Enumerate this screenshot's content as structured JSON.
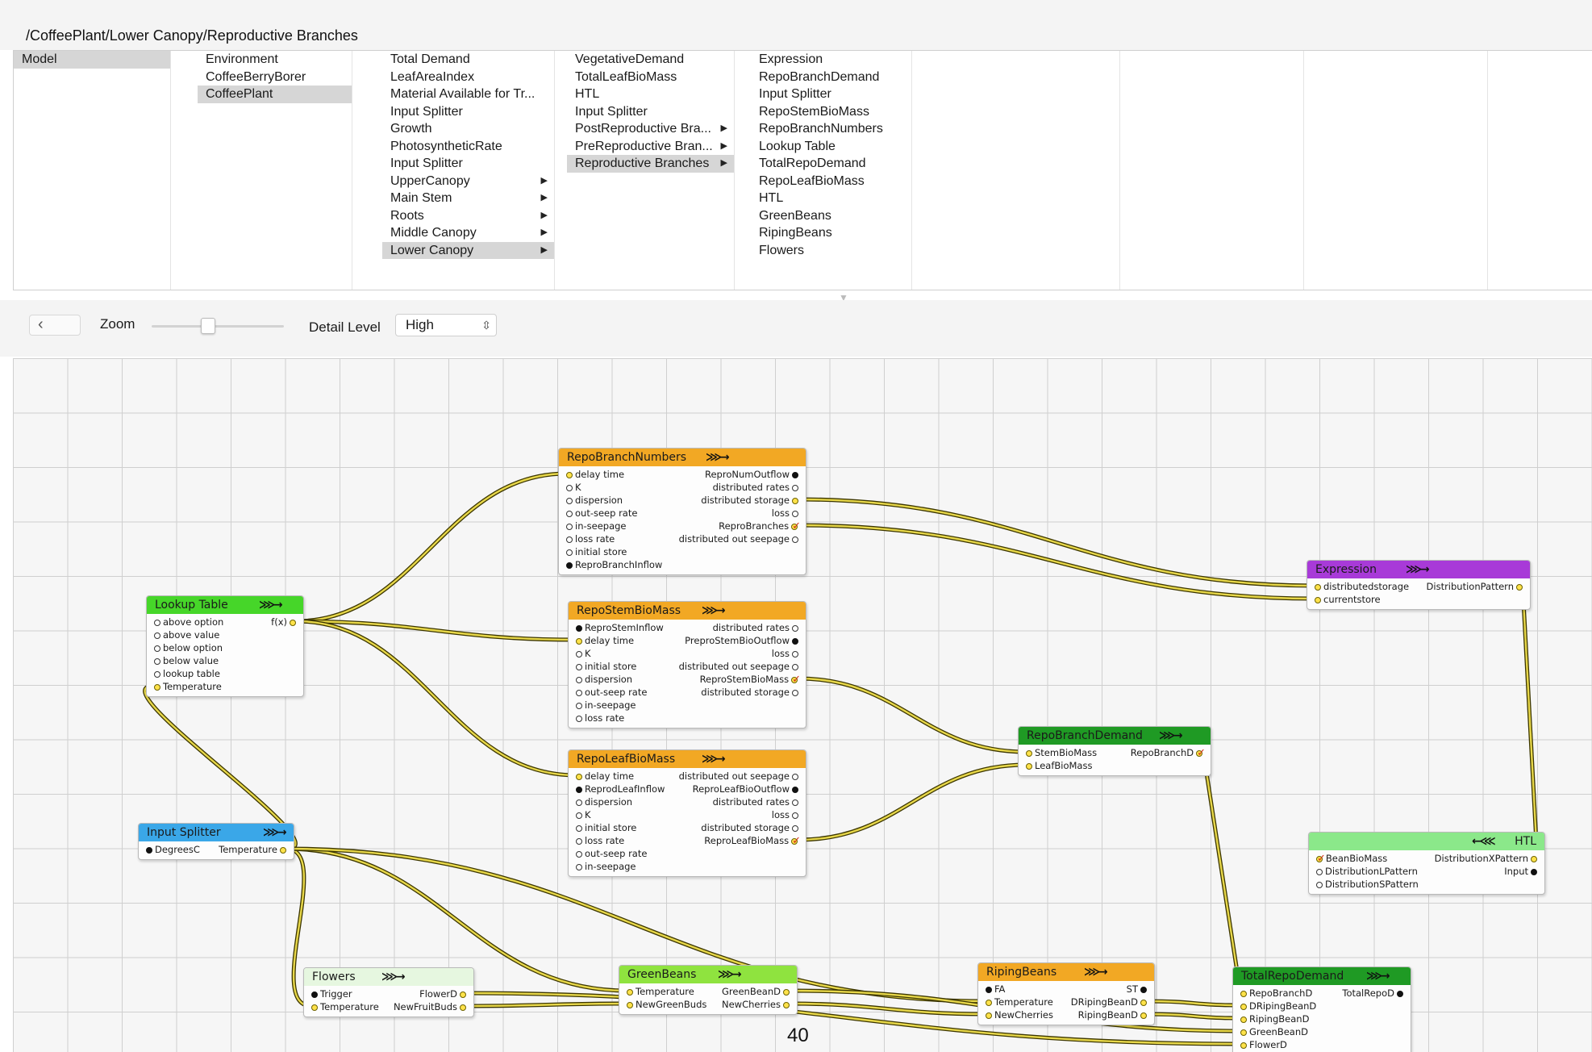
{
  "path": "/CoffeePlant/Lower Canopy/Reproductive Branches",
  "browser": {
    "columns": [
      {
        "items": [
          {
            "label": "Model",
            "selected": true,
            "arrow": false
          }
        ]
      },
      {
        "items": [
          {
            "label": "Environment",
            "selected": false,
            "arrow": false
          },
          {
            "label": "CoffeeBerryBorer",
            "selected": false,
            "arrow": false
          },
          {
            "label": "CoffeePlant",
            "selected": true,
            "arrow": false
          }
        ]
      },
      {
        "items": [
          {
            "label": "Total Demand",
            "selected": false,
            "arrow": false
          },
          {
            "label": "LeafAreaIndex",
            "selected": false,
            "arrow": false
          },
          {
            "label": "Material Available for Tr...",
            "selected": false,
            "arrow": false
          },
          {
            "label": "Input Splitter",
            "selected": false,
            "arrow": false
          },
          {
            "label": "Growth",
            "selected": false,
            "arrow": false
          },
          {
            "label": "PhotosyntheticRate",
            "selected": false,
            "arrow": false
          },
          {
            "label": "Input Splitter",
            "selected": false,
            "arrow": false
          },
          {
            "label": "UpperCanopy",
            "selected": false,
            "arrow": true
          },
          {
            "label": "Main Stem",
            "selected": false,
            "arrow": true
          },
          {
            "label": "Roots",
            "selected": false,
            "arrow": true
          },
          {
            "label": "Middle Canopy",
            "selected": false,
            "arrow": true
          },
          {
            "label": "Lower Canopy",
            "selected": true,
            "arrow": true
          }
        ]
      },
      {
        "items": [
          {
            "label": "VegetativeDemand",
            "selected": false,
            "arrow": false
          },
          {
            "label": "TotalLeafBioMass",
            "selected": false,
            "arrow": false
          },
          {
            "label": "HTL",
            "selected": false,
            "arrow": false
          },
          {
            "label": "Input Splitter",
            "selected": false,
            "arrow": false
          },
          {
            "label": "PostReproductive Bra...",
            "selected": false,
            "arrow": true
          },
          {
            "label": "PreReproductive Bran...",
            "selected": false,
            "arrow": true
          },
          {
            "label": "Reproductive Branches",
            "selected": true,
            "arrow": true
          }
        ]
      },
      {
        "items": [
          {
            "label": "Expression",
            "selected": false,
            "arrow": false
          },
          {
            "label": "RepoBranchDemand",
            "selected": false,
            "arrow": false
          },
          {
            "label": "Input Splitter",
            "selected": false,
            "arrow": false
          },
          {
            "label": "RepoStemBioMass",
            "selected": false,
            "arrow": false
          },
          {
            "label": "RepoBranchNumbers",
            "selected": false,
            "arrow": false
          },
          {
            "label": "Lookup Table",
            "selected": false,
            "arrow": false
          },
          {
            "label": "TotalRepoDemand",
            "selected": false,
            "arrow": false
          },
          {
            "label": "RepoLeafBioMass",
            "selected": false,
            "arrow": false
          },
          {
            "label": "HTL",
            "selected": false,
            "arrow": false
          },
          {
            "label": "GreenBeans",
            "selected": false,
            "arrow": false
          },
          {
            "label": "RipingBeans",
            "selected": false,
            "arrow": false
          },
          {
            "label": "Flowers",
            "selected": false,
            "arrow": false
          }
        ]
      },
      {
        "items": []
      },
      {
        "items": []
      },
      {
        "items": []
      },
      {
        "items": []
      }
    ]
  },
  "toolbar": {
    "back_icon": "‹",
    "zoom_label": "Zoom",
    "zoom_level": 0.42,
    "detail_label": "Detail Level",
    "detail_value": "High"
  },
  "colors": {
    "orange": "#f2a824",
    "green": "#46d629",
    "purple": "#a83ad8",
    "blue": "#3aa7e8",
    "dark_green": "#1f9a24",
    "light_green": "#8be88a",
    "pale_green": "#e6f7e0",
    "bright_green": "#8fe33f",
    "wire": "#e8d84a",
    "wire_edge": "#3c3600"
  },
  "nodes": [
    {
      "id": "RepoBranchNumbers",
      "title": "RepoBranchNumbers",
      "color": "orange",
      "glyph": "⋙→",
      "rows": [
        {
          "in": "delay time",
          "in_type": "y",
          "out": "ReproNumOutflow",
          "out_type": "f"
        },
        {
          "in": "K",
          "in_type": "o",
          "out": "distributed rates",
          "out_type": "o"
        },
        {
          "in": "dispersion",
          "in_type": "o",
          "out": "distributed storage",
          "out_type": "y"
        },
        {
          "in": "out-seep rate",
          "in_type": "o",
          "out": "loss",
          "out_type": "o"
        },
        {
          "in": "in-seepage",
          "in_type": "o",
          "out": "ReproBranches",
          "out_type": "y",
          "out_check": true
        },
        {
          "in": "loss rate",
          "in_type": "o",
          "out": "distributed out seepage",
          "out_type": "o"
        },
        {
          "in": "initial store",
          "in_type": "o",
          "out": "",
          "out_type": ""
        },
        {
          "in": "ReproBranchInflow",
          "in_type": "f",
          "out": "",
          "out_type": ""
        }
      ]
    },
    {
      "id": "RepoStemBioMass",
      "title": "RepoStemBioMass",
      "color": "orange",
      "glyph": "⋙→",
      "rows": [
        {
          "in": "ReproStemInflow",
          "in_type": "f",
          "out": "distributed rates",
          "out_type": "o"
        },
        {
          "in": "delay time",
          "in_type": "y",
          "out": "PreproStemBioOutflow",
          "out_type": "f"
        },
        {
          "in": "K",
          "in_type": "o",
          "out": "loss",
          "out_type": "o"
        },
        {
          "in": "initial store",
          "in_type": "o",
          "out": "distributed out seepage",
          "out_type": "o"
        },
        {
          "in": "dispersion",
          "in_type": "o",
          "out": "ReproStemBioMass",
          "out_type": "y",
          "out_check": true
        },
        {
          "in": "out-seep rate",
          "in_type": "o",
          "out": "distributed storage",
          "out_type": "o"
        },
        {
          "in": "in-seepage",
          "in_type": "o",
          "out": "",
          "out_type": ""
        },
        {
          "in": "loss rate",
          "in_type": "o",
          "out": "",
          "out_type": ""
        }
      ]
    },
    {
      "id": "RepoLeafBioMass",
      "title": "RepoLeafBioMass",
      "color": "orange",
      "glyph": "⋙→",
      "rows": [
        {
          "in": "delay time",
          "in_type": "y",
          "out": "distributed out seepage",
          "out_type": "o"
        },
        {
          "in": "ReprodLeafInflow",
          "in_type": "f",
          "out": "ReproLeafBioOutflow",
          "out_type": "f"
        },
        {
          "in": "dispersion",
          "in_type": "o",
          "out": "distributed rates",
          "out_type": "o"
        },
        {
          "in": "K",
          "in_type": "o",
          "out": "loss",
          "out_type": "o"
        },
        {
          "in": "initial store",
          "in_type": "o",
          "out": "distributed storage",
          "out_type": "o"
        },
        {
          "in": "loss rate",
          "in_type": "o",
          "out": "ReproLeafBioMass",
          "out_type": "y",
          "out_check": true
        },
        {
          "in": "out-seep rate",
          "in_type": "o",
          "out": "",
          "out_type": ""
        },
        {
          "in": "in-seepage",
          "in_type": "o",
          "out": "",
          "out_type": ""
        }
      ]
    },
    {
      "id": "LookupTable",
      "title": "Lookup Table",
      "color": "green",
      "glyph": "⋙→",
      "rows": [
        {
          "in": "above option",
          "in_type": "o",
          "out": "f(x)",
          "out_type": "y"
        },
        {
          "in": "above value",
          "in_type": "o",
          "out": "",
          "out_type": ""
        },
        {
          "in": "below option",
          "in_type": "o",
          "out": "",
          "out_type": ""
        },
        {
          "in": "below value",
          "in_type": "o",
          "out": "",
          "out_type": ""
        },
        {
          "in": "lookup table",
          "in_type": "o",
          "out": "",
          "out_type": ""
        },
        {
          "in": "Temperature",
          "in_type": "y",
          "out": "",
          "out_type": ""
        }
      ]
    },
    {
      "id": "Expression",
      "title": "Expression",
      "color": "purple",
      "glyph": "⋙→",
      "rows": [
        {
          "in": "distributedstorage",
          "in_type": "y",
          "out": "DistributionPattern",
          "out_type": "y"
        },
        {
          "in": "currentstore",
          "in_type": "y",
          "out": "",
          "out_type": ""
        }
      ]
    },
    {
      "id": "RepoBranchDemand",
      "title": "RepoBranchDemand",
      "color": "dark_green",
      "glyph": "⋙→",
      "rows": [
        {
          "in": "StemBioMass",
          "in_type": "y",
          "out": "RepoBranchD",
          "out_type": "y",
          "out_check": true
        },
        {
          "in": "LeafBioMass",
          "in_type": "y",
          "out": "",
          "out_type": ""
        }
      ]
    },
    {
      "id": "InputSplitter",
      "title": "Input Splitter",
      "color": "blue",
      "glyph": "⋙→",
      "rows": [
        {
          "in": "DegreesC",
          "in_type": "f",
          "out": "Temperature",
          "out_type": "y"
        }
      ]
    },
    {
      "id": "HTL",
      "title": "HTL",
      "color": "light_green",
      "glyph": "←⋘",
      "rows": [
        {
          "in": "BeanBioMass",
          "in_type": "y",
          "in_check": true,
          "out": "DistributionXPattern",
          "out_type": "y"
        },
        {
          "in": "DistributionLPattern",
          "in_type": "o",
          "out": "Input",
          "out_type": "f"
        },
        {
          "in": "DistributionSPattern",
          "in_type": "o",
          "out": "",
          "out_type": ""
        }
      ]
    },
    {
      "id": "Flowers",
      "title": "Flowers",
      "color": "pale_green",
      "glyph": "⋙→",
      "rows": [
        {
          "in": "Trigger",
          "in_type": "f",
          "out": "FlowerD",
          "out_type": "y"
        },
        {
          "in": "Temperature",
          "in_type": "y",
          "out": "NewFruitBuds",
          "out_type": "y"
        }
      ]
    },
    {
      "id": "GreenBeans",
      "title": "GreenBeans",
      "color": "bright_green",
      "glyph": "⋙→",
      "rows": [
        {
          "in": "Temperature",
          "in_type": "y",
          "out": "GreenBeanD",
          "out_type": "y"
        },
        {
          "in": "NewGreenBuds",
          "in_type": "y",
          "out": "NewCherries",
          "out_type": "y"
        }
      ]
    },
    {
      "id": "RipingBeans",
      "title": "RipingBeans",
      "color": "orange",
      "glyph": "⋙→",
      "rows": [
        {
          "in": "FA",
          "in_type": "f",
          "out": "ST",
          "out_type": "f"
        },
        {
          "in": "Temperature",
          "in_type": "y",
          "out": "DRipingBeanD",
          "out_type": "y"
        },
        {
          "in": "NewCherries",
          "in_type": "y",
          "out": "RipingBeanD",
          "out_type": "y"
        }
      ]
    },
    {
      "id": "TotalRepoDemand",
      "title": "TotalRepoDemand",
      "color": "dark_green",
      "glyph": "⋙→",
      "rows": [
        {
          "in": "RepoBranchD",
          "in_type": "y",
          "out": "TotalRepoD",
          "out_type": "f"
        },
        {
          "in": "DRipingBeanD",
          "in_type": "y",
          "out": "",
          "out_type": ""
        },
        {
          "in": "RipingBeanD",
          "in_type": "y",
          "out": "",
          "out_type": ""
        },
        {
          "in": "GreenBeanD",
          "in_type": "y",
          "out": "",
          "out_type": ""
        },
        {
          "in": "FlowerD",
          "in_type": "y",
          "out": "",
          "out_type": ""
        }
      ]
    }
  ],
  "page_number": "40"
}
